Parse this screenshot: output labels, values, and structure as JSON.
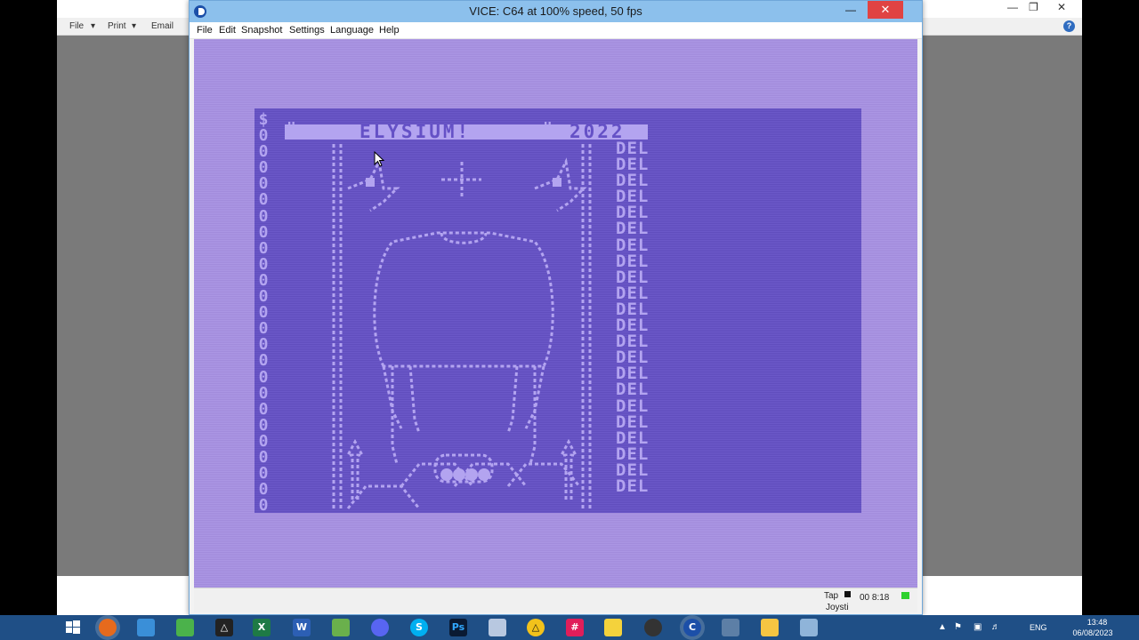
{
  "background_window": {
    "toolbar": {
      "file_label": "File",
      "print_label": "Print",
      "email_label": "Email"
    }
  },
  "vice": {
    "title": "VICE: C64 at 100% speed, 50 fps",
    "menu": [
      "File",
      "Edit",
      "Snapshot",
      "Settings",
      "Language",
      "Help"
    ],
    "screen": {
      "top_left_char": "$",
      "title_open_quote": "\"",
      "title": "ELYSIUM!",
      "title_close_quote": "\"",
      "year": "2022",
      "row_value": "0",
      "row_count": 24,
      "del_label": "DEL",
      "del_count": 22
    },
    "status": {
      "tape_label": "Tap",
      "counter": "00 8:18",
      "joystick_label": "Joysti"
    },
    "colors": {
      "border": "#a790e3",
      "background": "#6551c6",
      "foreground": "#b3a4f0"
    }
  },
  "taskbar": {
    "icons": [
      "windows-start-icon",
      "firefox-icon",
      "mail-icon",
      "app-icon",
      "unity-icon",
      "excel-icon",
      "word-icon",
      "image-editor-icon",
      "discord-icon",
      "skype-icon",
      "photoshop-icon",
      "notepad-icon",
      "alert-app-icon",
      "slack-icon",
      "sticky-icon",
      "obs-icon",
      "vice-c64-icon",
      "display-icon",
      "file-explorer-icon",
      "utility-icon"
    ],
    "excel_label": "X",
    "word_label": "W",
    "skype_label": "S",
    "photoshop_label": "Ps",
    "tray": {
      "language": "ENG",
      "time": "13:48",
      "date": "06/08/2023"
    }
  }
}
